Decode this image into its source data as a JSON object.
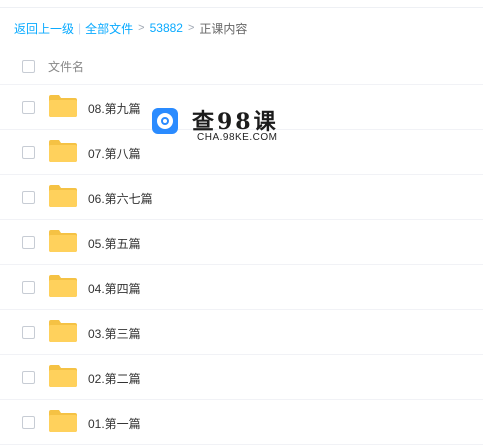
{
  "breadcrumb": {
    "back": "返回上一级",
    "separator": "|",
    "all_files": "全部文件",
    "folder": "53882",
    "current": "正课内容"
  },
  "table": {
    "column_name": "文件名",
    "rows": [
      {
        "name": "08.第九篇"
      },
      {
        "name": "07.第八篇"
      },
      {
        "name": "06.第六七篇"
      },
      {
        "name": "05.第五篇"
      },
      {
        "name": "04.第四篇"
      },
      {
        "name": "03.第三篇"
      },
      {
        "name": "02.第二篇"
      },
      {
        "name": "01.第一篇"
      }
    ]
  },
  "watermark": {
    "title": "查98课",
    "subtitle": "CHA.98KE.COM"
  },
  "colors": {
    "link": "#09aaff",
    "folder": "#ffd15c",
    "folder_tab": "#f5c244"
  }
}
